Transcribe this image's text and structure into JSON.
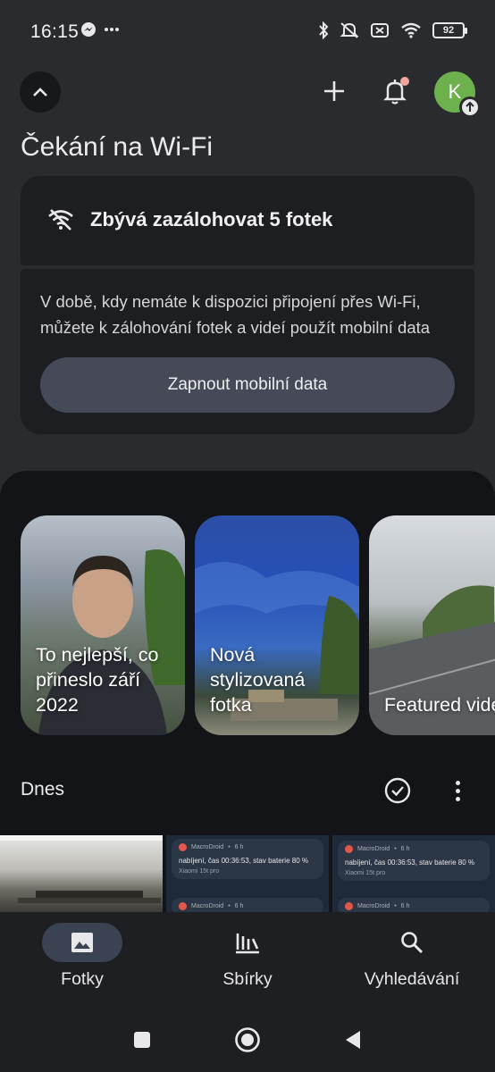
{
  "status_bar": {
    "time": "16:15",
    "left_icons": [
      "messenger-icon",
      "more-dots-icon"
    ],
    "right_icons": [
      "bluetooth-icon",
      "mute-icon",
      "no-sim-icon",
      "wifi-icon"
    ],
    "battery": "92"
  },
  "header": {
    "title": "Čekání na Wi-Fi",
    "avatar_letter": "K"
  },
  "backup_card": {
    "headline": "Zbývá zazálohovat 5 fotek",
    "description": "V době, kdy nemáte k dispozici připojení přes Wi-Fi, můžete k zálohování fotek a videí použít mobilní data",
    "button_label": "Zapnout mobilní data"
  },
  "memories": [
    {
      "title": "To nejlepší, co přineslo září 2022"
    },
    {
      "title": "Nová stylizovaná fotka"
    },
    {
      "title": "Featured video"
    }
  ],
  "today_section": {
    "label": "Dnes"
  },
  "thumbnail_notifications": {
    "app": "MacroDroid",
    "age": "6 h",
    "text": "nabíjení, čas 00:36:53, stav baterie 80 %",
    "device": "Xiaomi 15t pro"
  },
  "bottom_nav": {
    "items": [
      {
        "label": "Fotky",
        "icon": "photo-icon",
        "active": true
      },
      {
        "label": "Sbírky",
        "icon": "library-icon",
        "active": false
      },
      {
        "label": "Vyhledávání",
        "icon": "search-icon",
        "active": false
      }
    ]
  },
  "colors": {
    "background": "#2a2b2f",
    "panel": "#131417",
    "card": "#1d1e22",
    "button": "#464a58",
    "avatar": "#6db04e",
    "notification_dot": "#f3a69d",
    "active_nav": "#3b4252"
  }
}
